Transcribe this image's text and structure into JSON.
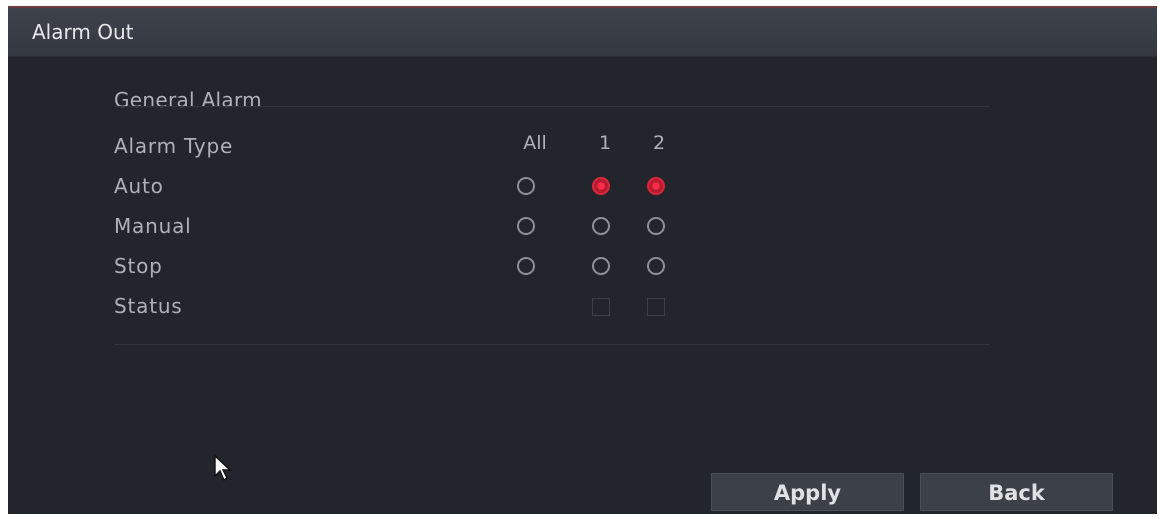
{
  "window": {
    "title": "Alarm Out"
  },
  "general": {
    "section_title": "General Alarm",
    "column_headers": [
      "All",
      "1",
      "2"
    ],
    "rows": [
      {
        "label": "Alarm Type"
      },
      {
        "label": "Auto",
        "selected": [
          false,
          true,
          true
        ]
      },
      {
        "label": "Manual",
        "selected": [
          false,
          false,
          false
        ]
      },
      {
        "label": "Stop",
        "selected": [
          false,
          false,
          false
        ]
      },
      {
        "label": "Status"
      }
    ]
  },
  "buttons": {
    "apply": "Apply",
    "back": "Back"
  },
  "colors": {
    "accent_selected": "#d9263b",
    "panel_bg": "#22252b"
  }
}
